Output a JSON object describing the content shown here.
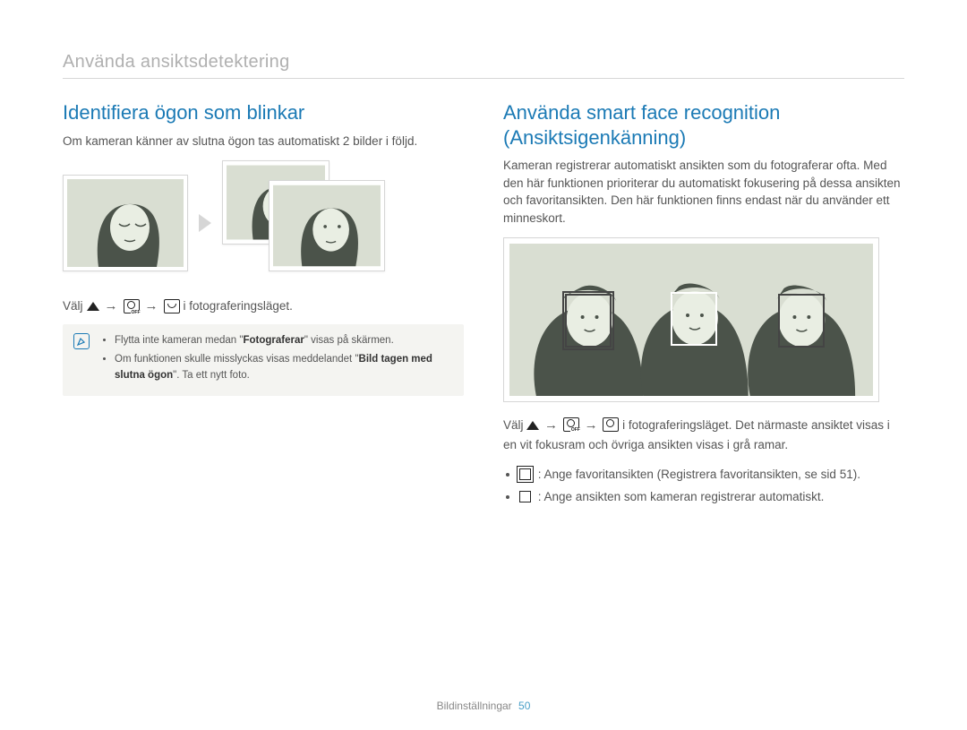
{
  "section_title": "Använda ansiktsdetektering",
  "left": {
    "heading": "Identifiera ögon som blinkar",
    "intro": "Om kameran känner av slutna ögon tas automatiskt 2 bilder i följd.",
    "instruct_prefix": "Välj",
    "instruct_suffix": "i fotograferingsläget.",
    "note": {
      "item1_pre": "Flytta inte kameran medan \"",
      "item1_bold": "Fotograferar",
      "item1_post": "\" visas på skärmen.",
      "item2_pre": "Om funktionen skulle misslyckas visas meddelandet \"",
      "item2_bold": "Bild tagen med slutna ögon",
      "item2_post": "\". Ta ett nytt foto."
    }
  },
  "right": {
    "heading": "Använda smart face recognition (Ansiktsigenkänning)",
    "intro": "Kameran registrerar automatiskt ansikten som du fotograferar ofta. Med den här funktionen prioriterar du automatiskt fokusering på dessa ansikten och favoritansikten. Den här funktionen finns endast när du använder ett minneskort.",
    "instruct_prefix": "Välj",
    "instruct_mid": "i fotograferingsläget. Det närmaste ansiktet visas i en vit fokusram och övriga ansikten visas i grå ramar.",
    "bullet1": "Ange favoritansikten (Registrera favoritansikten, se sid 51).",
    "bullet2": "Ange ansikten som kameran registrerar automatiskt."
  },
  "footer": {
    "label": "Bildinställningar",
    "page": "50"
  }
}
